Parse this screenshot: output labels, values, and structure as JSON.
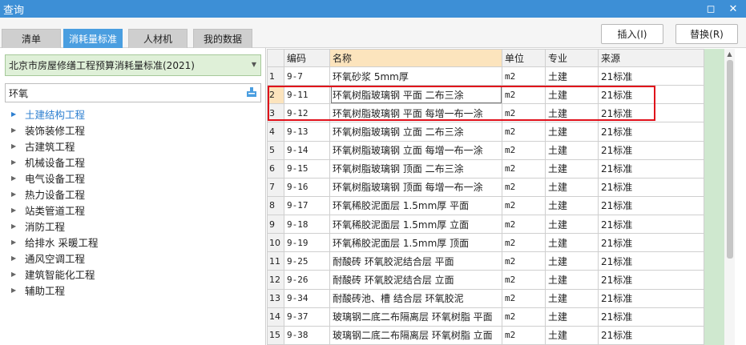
{
  "window": {
    "title": "查询",
    "restore_glyph": "◻",
    "close_glyph": "✕"
  },
  "tabs": [
    {
      "label": "清单"
    },
    {
      "label": "消耗量标准"
    },
    {
      "label": "人材机"
    },
    {
      "label": "我的数据"
    }
  ],
  "buttons": {
    "insert": "插入(I)",
    "replace": "替换(R)"
  },
  "standard_select": {
    "value": "北京市房屋修缮工程预算消耗量标准(2021)"
  },
  "search": {
    "value": "环氧"
  },
  "tree": [
    {
      "label": "土建结构工程"
    },
    {
      "label": "装饰装修工程"
    },
    {
      "label": "古建筑工程"
    },
    {
      "label": "机械设备工程"
    },
    {
      "label": "电气设备工程"
    },
    {
      "label": "热力设备工程"
    },
    {
      "label": "站类管道工程"
    },
    {
      "label": "消防工程"
    },
    {
      "label": "给排水 采暖工程"
    },
    {
      "label": "通风空调工程"
    },
    {
      "label": "建筑智能化工程"
    },
    {
      "label": "辅助工程"
    }
  ],
  "grid": {
    "columns": [
      "编码",
      "名称",
      "单位",
      "专业",
      "来源"
    ],
    "rows": [
      {
        "no": "1",
        "code": "9-7",
        "name": "环氧砂浆 5mm厚",
        "unit": "m2",
        "major": "土建",
        "source": "21标准"
      },
      {
        "no": "2",
        "code": "9-11",
        "name": "环氧树脂玻璃钢 平面 二布三涂",
        "unit": "m2",
        "major": "土建",
        "source": "21标准"
      },
      {
        "no": "3",
        "code": "9-12",
        "name": "环氧树脂玻璃钢 平面 每增一布一涂",
        "unit": "m2",
        "major": "土建",
        "source": "21标准"
      },
      {
        "no": "4",
        "code": "9-13",
        "name": "环氧树脂玻璃钢 立面 二布三涂",
        "unit": "m2",
        "major": "土建",
        "source": "21标准"
      },
      {
        "no": "5",
        "code": "9-14",
        "name": "环氧树脂玻璃钢 立面 每增一布一涂",
        "unit": "m2",
        "major": "土建",
        "source": "21标准"
      },
      {
        "no": "6",
        "code": "9-15",
        "name": "环氧树脂玻璃钢 顶面 二布三涂",
        "unit": "m2",
        "major": "土建",
        "source": "21标准"
      },
      {
        "no": "7",
        "code": "9-16",
        "name": "环氧树脂玻璃钢 顶面 每增一布一涂",
        "unit": "m2",
        "major": "土建",
        "source": "21标准"
      },
      {
        "no": "8",
        "code": "9-17",
        "name": "环氧稀胶泥面层 1.5mm厚 平面",
        "unit": "m2",
        "major": "土建",
        "source": "21标准"
      },
      {
        "no": "9",
        "code": "9-18",
        "name": "环氧稀胶泥面层 1.5mm厚 立面",
        "unit": "m2",
        "major": "土建",
        "source": "21标准"
      },
      {
        "no": "10",
        "code": "9-19",
        "name": "环氧稀胶泥面层 1.5mm厚 顶面",
        "unit": "m2",
        "major": "土建",
        "source": "21标准"
      },
      {
        "no": "11",
        "code": "9-25",
        "name": "耐酸砖 环氧胶泥结合层 平面",
        "unit": "m2",
        "major": "土建",
        "source": "21标准"
      },
      {
        "no": "12",
        "code": "9-26",
        "name": "耐酸砖 环氧胶泥结合层 立面",
        "unit": "m2",
        "major": "土建",
        "source": "21标准"
      },
      {
        "no": "13",
        "code": "9-34",
        "name": "耐酸砖池、槽 结合层 环氧胶泥",
        "unit": "m2",
        "major": "土建",
        "source": "21标准"
      },
      {
        "no": "14",
        "code": "9-37",
        "name": "玻璃钢二底二布隔离层 环氧树脂 平面",
        "unit": "m2",
        "major": "土建",
        "source": "21标准"
      },
      {
        "no": "15",
        "code": "9-38",
        "name": "玻璃钢二底二布隔离层 环氧树脂 立面",
        "unit": "m2",
        "major": "土建",
        "source": "21标准"
      }
    ]
  }
}
